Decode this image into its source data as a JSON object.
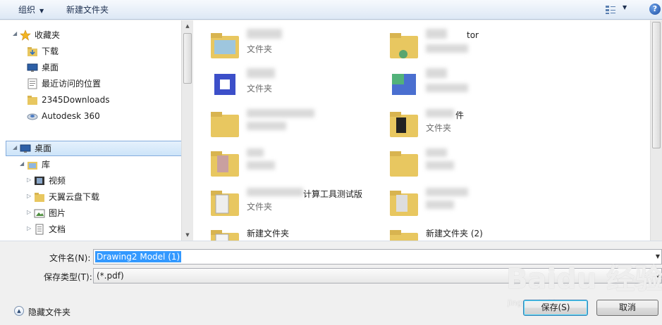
{
  "toolbar": {
    "organize_label": "组织",
    "new_folder_label": "新建文件夹",
    "help_label": "?"
  },
  "nav": {
    "favorites_label": "收藏夹",
    "favorites": [
      {
        "label": "下载",
        "icon": "download-folder-icon"
      },
      {
        "label": "桌面",
        "icon": "desktop-icon"
      },
      {
        "label": "最近访问的位置",
        "icon": "recent-places-icon"
      },
      {
        "label": "2345Downloads",
        "icon": "folder-icon"
      },
      {
        "label": "Autodesk 360",
        "icon": "cloud-drive-icon"
      }
    ],
    "desktop_label": "桌面",
    "libraries_label": "库",
    "libraries": [
      {
        "label": "视频",
        "icon": "video-library-icon"
      },
      {
        "label": "天翼云盘下载",
        "icon": "folder-icon"
      },
      {
        "label": "图片",
        "icon": "pictures-library-icon"
      },
      {
        "label": "文档",
        "icon": "documents-library-icon"
      }
    ]
  },
  "files": [
    {
      "name": "",
      "type": "文件夹"
    },
    {
      "name": "tor",
      "type": ""
    },
    {
      "name": "",
      "type": "文件夹"
    },
    {
      "name": "",
      "type": ""
    },
    {
      "name": "",
      "type": ""
    },
    {
      "name": "件",
      "type": "文件夹"
    },
    {
      "name": "",
      "type": ""
    },
    {
      "name": "",
      "type": ""
    },
    {
      "name": "计算工具测试版",
      "type": "文件夹"
    },
    {
      "name": "",
      "type": ""
    },
    {
      "name": "新建文件夹",
      "type": ""
    },
    {
      "name": "新建文件夹 (2)",
      "type": ""
    }
  ],
  "form": {
    "filename_label": "文件名(N):",
    "filename_value": "Drawing2 Model (1)",
    "savetype_label": "保存类型(T):",
    "savetype_value": "(*.pdf)",
    "hide_folders_label": "隐藏文件夹",
    "save_button": "保存(S)",
    "cancel_button": "取消"
  },
  "watermark": {
    "text": "Baidu 经验",
    "sub": "jingyan.baidu.com"
  },
  "colors": {
    "selection": "#3399ff",
    "toolbar_top": "#f6f9fd",
    "toolbar_bottom": "#dde8f5",
    "nav_selected": "#cde4f9",
    "folder": "#e8c760"
  }
}
